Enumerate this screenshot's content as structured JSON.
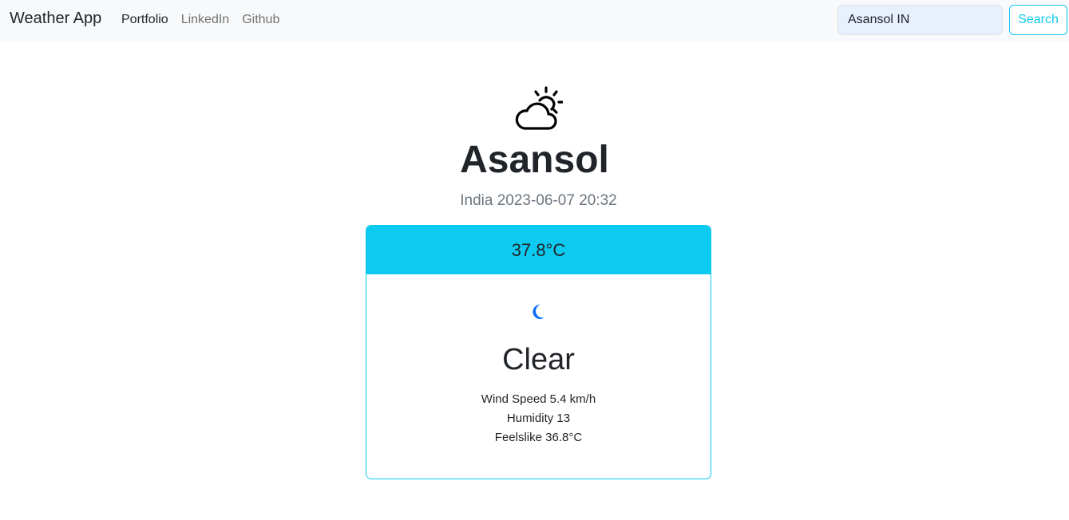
{
  "navbar": {
    "brand": "Weather App",
    "links": [
      {
        "label": "Portfolio",
        "active": true
      },
      {
        "label": "LinkedIn",
        "active": false
      },
      {
        "label": "Github",
        "active": false
      }
    ],
    "search": {
      "value": "Asansol IN",
      "button_label": "Search"
    }
  },
  "location": {
    "icon": "cloud-sun-icon",
    "city": "Asansol",
    "country_datetime": "India 2023-06-07 20:32"
  },
  "card": {
    "temperature": "37.8°C",
    "icon": "moon-icon",
    "condition": "Clear",
    "wind_speed": "Wind Speed 5.4 km/h",
    "humidity": "Humidity 13",
    "feelslike": "Feelslike 36.8°C"
  },
  "colors": {
    "accent": "#0dcaf0",
    "navbar_bg": "#f8f9fa",
    "moon": "#0d6efd"
  }
}
